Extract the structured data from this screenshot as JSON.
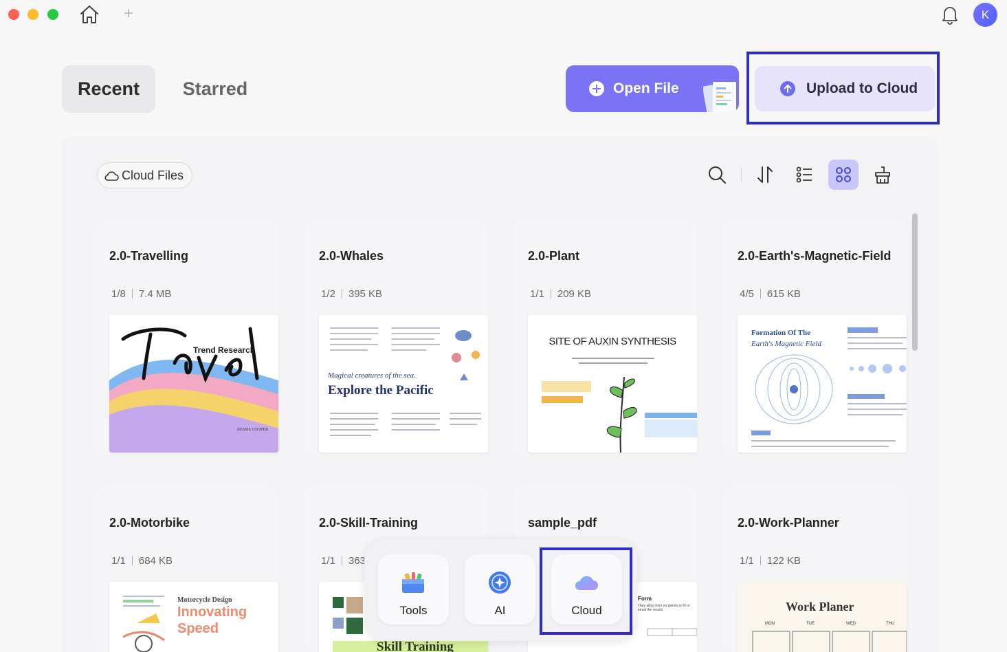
{
  "titlebar": {
    "avatar_initial": "K",
    "new_tab": "+"
  },
  "tabs": [
    {
      "label": "Recent",
      "selected": true
    },
    {
      "label": "Starred",
      "selected": false
    }
  ],
  "actions": {
    "open_file": "Open File",
    "upload_to_cloud": "Upload to Cloud"
  },
  "panel": {
    "cloud_chip": "Cloud Files",
    "tools": [
      "search-icon",
      "sort-icon",
      "list-view-icon",
      "grid-view-icon",
      "clean-icon"
    ],
    "active_view": "grid-view-icon"
  },
  "files": [
    {
      "name": "2.0-Travelling",
      "pages": "1/8",
      "size": "7.4 MB"
    },
    {
      "name": "2.0-Whales",
      "pages": "1/2",
      "size": "395 KB"
    },
    {
      "name": "2.0-Plant",
      "pages": "1/1",
      "size": "209 KB"
    },
    {
      "name": "2.0-Earth's-Magnetic-Field",
      "pages": "4/5",
      "size": "615 KB"
    },
    {
      "name": "2.0-Motorbike",
      "pages": "1/1",
      "size": "684 KB"
    },
    {
      "name": "2.0-Skill-Training",
      "pages": "1/1",
      "size": "363"
    },
    {
      "name": "sample_pdf",
      "pages": "",
      "size": ""
    },
    {
      "name": "2.0-Work-Planner",
      "pages": "1/1",
      "size": "122 KB"
    }
  ],
  "thumbnails": {
    "travel": {
      "title": "Travel",
      "badge": "Trend Research",
      "author": "BESSIE COOPER"
    },
    "whales": {
      "kicker": "Magical creatures of the sea.",
      "title": "Explore the Pacific"
    },
    "plant": {
      "title": "SITE OF AUXIN SYNTHESIS"
    },
    "earth": {
      "title_1": "Formation Of The",
      "title_2": "Earth's Magnetic Field"
    },
    "motorbike": {
      "line_1": "Motorcycle Design",
      "line_2": "Innovating",
      "line_3": "Speed"
    },
    "skill": {
      "title": "Skill Training"
    },
    "sample": {
      "title": "Form",
      "sub": "They allow form recipients to fill or email the results"
    },
    "planner": {
      "title": "Work Planer",
      "days": [
        "MON",
        "TUE",
        "WED",
        "THU"
      ]
    }
  },
  "dock": [
    {
      "label": "Tools",
      "icon": "toolbox-icon"
    },
    {
      "label": "AI",
      "icon": "ai-assistant-icon"
    },
    {
      "label": "Cloud",
      "icon": "cloud-icon"
    }
  ],
  "colors": {
    "accent": "#7b72f5",
    "highlight": "#2f2dc6",
    "active_view_bg": "#c9c6f9"
  }
}
